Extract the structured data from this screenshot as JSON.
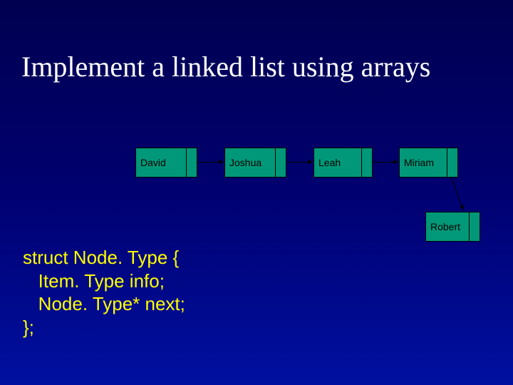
{
  "title": "Implement a linked list using arrays",
  "nodes": {
    "n0": "David",
    "n1": "Joshua",
    "n2": "Leah",
    "n3": "Miriam",
    "n4": "Robert"
  },
  "code": {
    "l1": "struct Node. Type {",
    "l2": "   Item. Type info;",
    "l3": "   Node. Type* next;",
    "l4": "};"
  },
  "chart_data": {
    "type": "diagram",
    "title": "Linked list nodes",
    "series": [
      {
        "name": "node",
        "values": [
          "David",
          "Joshua",
          "Leah",
          "Miriam",
          "Robert"
        ]
      }
    ],
    "links": [
      [
        "David",
        "Joshua"
      ],
      [
        "Joshua",
        "Leah"
      ],
      [
        "Leah",
        "Miriam"
      ],
      [
        "Miriam",
        "Robert"
      ]
    ]
  }
}
